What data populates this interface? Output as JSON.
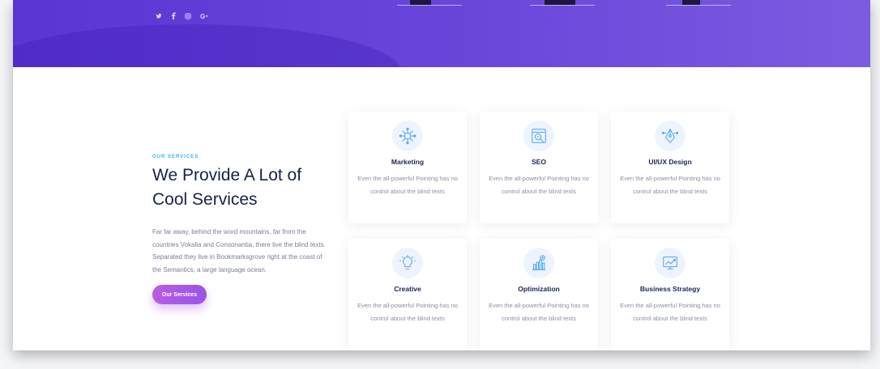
{
  "social": [
    "twitter-icon",
    "facebook-icon",
    "instagram-icon",
    "google-plus-icon"
  ],
  "services": {
    "eyebrow": "OUR SERVICES",
    "headline": "We Provide A Lot of Cool Services",
    "description": "Far far away, behind the word mountains, far from the countries Vokalia and Consonantia, there live the blind texts. Separated they live in Bookmarksgrove right at the coast of the Semantics, a large language ocean.",
    "cta_label": "Our Services",
    "cards": [
      {
        "title": "Marketing",
        "text": "Even the all-powerful Pointing has no control about the blind texts",
        "icon": "marketing-icon"
      },
      {
        "title": "SEO",
        "text": "Even the all-powerful Pointing has no control about the blind texts",
        "icon": "seo-icon"
      },
      {
        "title": "UI/UX Design",
        "text": "Even the all-powerful Pointing has no control about the blind texts",
        "icon": "design-icon"
      },
      {
        "title": "Creative",
        "text": "Even the all-powerful Pointing has no control about the blind texts",
        "icon": "lightbulb-icon"
      },
      {
        "title": "Optimization",
        "text": "Even the all-powerful Pointing has no control about the blind texts",
        "icon": "chart-icon"
      },
      {
        "title": "Business Strategy",
        "text": "Even the all-powerful Pointing has no control about the blind texts",
        "icon": "strategy-icon"
      }
    ]
  },
  "colors": {
    "hero_start": "#5a35d2",
    "hero_end": "#7b5ce0",
    "accent_blue": "#35b7f0",
    "cta_purple": "#b95ee4",
    "heading": "#17214a"
  }
}
